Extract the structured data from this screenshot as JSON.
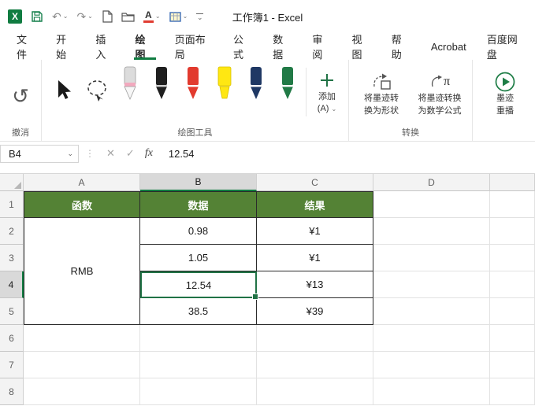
{
  "titlebar": {
    "title": "工作簿1 - Excel",
    "font_color_letter": "A"
  },
  "glyphs": {
    "undo": "↶",
    "redo": "↷",
    "big_undo": "↺",
    "dropdown": "⌄",
    "cancel": "✕",
    "enter": "✓",
    "dots": "⋮"
  },
  "tabs": [
    "文件",
    "开始",
    "插入",
    "绘图",
    "页面布局",
    "公式",
    "数据",
    "审阅",
    "视图",
    "帮助",
    "Acrobat",
    "百度网盘"
  ],
  "ribbon": {
    "undo_group_label": "撤消",
    "draw_group_label": "绘图工具",
    "add_button": {
      "line1": "添加",
      "line2": "(A)"
    },
    "convert_group_label": "转换",
    "convert_shape": {
      "line1": "将墨迹转",
      "line2": "换为形状"
    },
    "convert_math": {
      "line1": "将墨迹转换",
      "line2": "为数学公式"
    },
    "replay_button": {
      "line1": "墨迹",
      "line2": "重播"
    }
  },
  "formula_bar": {
    "name_box": "B4",
    "fx_label": "fx",
    "value": "12.54"
  },
  "sheet": {
    "col_headers": [
      "A",
      "B",
      "C",
      "D"
    ],
    "row_headers": [
      "1",
      "2",
      "3",
      "4",
      "5",
      "6",
      "7",
      "8"
    ],
    "selected_cell": "B4",
    "cells": {
      "r1": {
        "A": "函数",
        "B": "数据",
        "C": "结果"
      },
      "merged_A2_A5": "RMB",
      "r2": {
        "B": "0.98",
        "C": "¥1"
      },
      "r3": {
        "B": "1.05",
        "C": "¥1"
      },
      "r4": {
        "B": "12.54",
        "C": "¥13"
      },
      "r5": {
        "B": "38.5",
        "C": "¥39"
      }
    }
  },
  "colors": {
    "excel_green": "#107C41",
    "table_header_fill": "#548235",
    "selection": "#217346"
  }
}
